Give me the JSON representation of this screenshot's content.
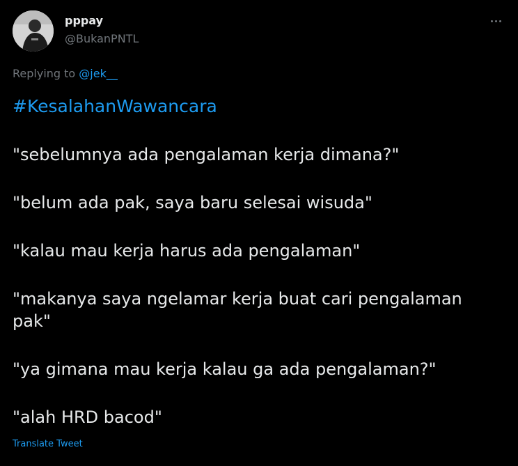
{
  "tweet": {
    "display_name": "pppay",
    "handle": "@BukanPNTL",
    "more_icon": "more-horizontal-icon",
    "replying_prefix": "Replying to ",
    "replying_handle": "@jek__",
    "hashtag": "#KesalahanWawancara",
    "paragraphs": [
      "\"sebelumnya ada pengalaman kerja dimana?\"",
      "\"belum ada pak, saya baru selesai wisuda\"",
      "\"kalau mau kerja harus ada pengalaman\"",
      "\"makanya saya ngelamar kerja buat cari pengalaman pak\"",
      "\"ya gimana mau kerja kalau ga ada pengalaman?\"",
      "\"alah HRD bacod\""
    ],
    "translate_label": "Translate Tweet"
  },
  "colors": {
    "background": "#000000",
    "text": "#e7e9ea",
    "secondary": "#71767b",
    "link": "#1d9bf0"
  }
}
